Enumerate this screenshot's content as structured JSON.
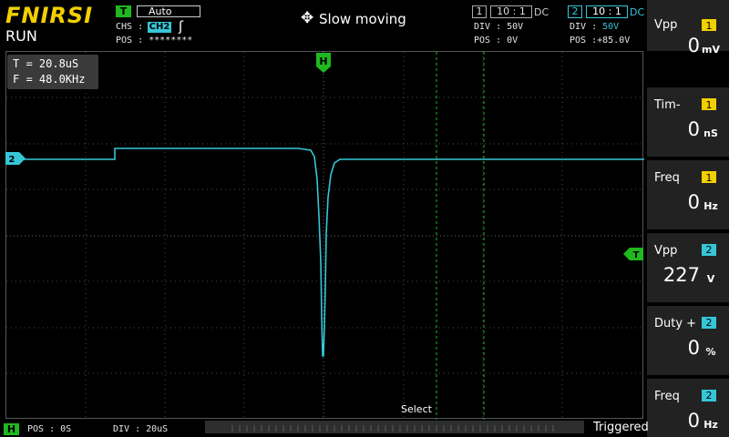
{
  "header": {
    "logo": "FNIRSI",
    "run_state": "RUN",
    "trigger_badge": "T",
    "trigger_mode": "Auto",
    "chs_label": "CHS :",
    "chs_value": "CH2",
    "edge_icon": "rising-edge-icon",
    "pos_label": "POS : ********",
    "mode_title": "Slow moving",
    "mode_icon": "move-arrows-icon"
  },
  "channels": {
    "ch1": {
      "num": "1",
      "probe": "10 : 1",
      "coupling": "DC",
      "div": "DIV :  50V",
      "pos": "POS : 0V"
    },
    "ch2": {
      "num": "2",
      "probe": "10 : 1",
      "coupling": "DC",
      "div_label": "DIV :",
      "div_value": "50V",
      "pos_label": "POS :",
      "pos_value": "+85.0V"
    }
  },
  "cursor_readout": {
    "t": "T = 20.8uS",
    "f": "F = 48.0KHz"
  },
  "markers": {
    "h": "H",
    "ch2": "2",
    "trigger": "T"
  },
  "select_label": "Select",
  "measurements": [
    {
      "name": "Vpp",
      "channel": "1",
      "value": "0",
      "unit": "mV"
    },
    {
      "name": "Tim-",
      "channel": "1",
      "value": "0",
      "unit": "nS"
    },
    {
      "name": "Freq",
      "channel": "1",
      "value": "0",
      "unit": "Hz"
    },
    {
      "name": "Vpp",
      "channel": "2",
      "value": "227",
      "unit": "V"
    },
    {
      "name": "Duty +",
      "channel": "2",
      "value": "0",
      "unit": "%"
    },
    {
      "name": "Freq",
      "channel": "2",
      "value": "0",
      "unit": "Hz"
    }
  ],
  "bottom": {
    "h_badge": "H",
    "pos": "POS : 0S",
    "div": "DIV : 20uS",
    "status": "Triggered"
  },
  "colors": {
    "brand": "#f2d000",
    "ch1": "#f2d000",
    "ch2": "#35c7d8",
    "trigger": "#1fb81f",
    "cursor": "#1fb81f"
  }
}
